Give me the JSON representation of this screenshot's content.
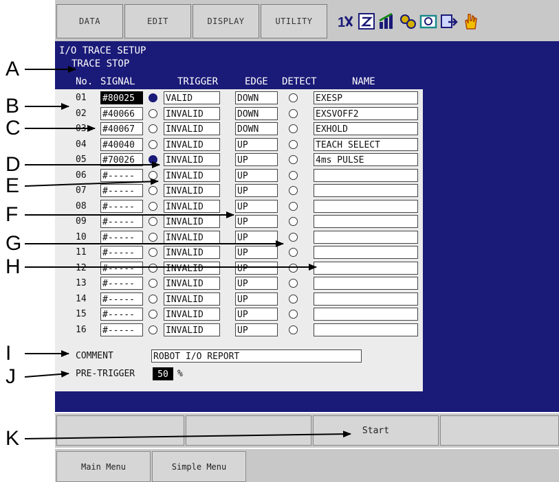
{
  "menu": [
    "DATA",
    "EDIT",
    "DISPLAY",
    "UTILITY"
  ],
  "toolbar_icons": [
    "io-icon",
    "calculator-icon",
    "signal-icon",
    "gears-icon",
    "camera-icon",
    "export-icon",
    "hand-icon"
  ],
  "screen": {
    "title": "I/O TRACE SETUP",
    "status": "TRACE STOP",
    "headers": {
      "no": "No.",
      "signal": "SIGNAL",
      "trigger": "TRIGGER",
      "edge": "EDGE",
      "detect": "DETECT",
      "name": "NAME"
    },
    "rows": [
      {
        "no": "01",
        "signal": "#80025",
        "trigger_on": true,
        "trigger": "VALID",
        "edge": "DOWN",
        "name": "EXESP"
      },
      {
        "no": "02",
        "signal": "#40066",
        "trigger_on": false,
        "trigger": "INVALID",
        "edge": "DOWN",
        "name": "EXSVOFF2"
      },
      {
        "no": "03",
        "signal": "#40067",
        "trigger_on": false,
        "trigger": "INVALID",
        "edge": "DOWN",
        "name": "EXHOLD"
      },
      {
        "no": "04",
        "signal": "#40040",
        "trigger_on": false,
        "trigger": "INVALID",
        "edge": "UP",
        "name": "TEACH SELECT"
      },
      {
        "no": "05",
        "signal": "#70026",
        "trigger_on": true,
        "trigger": "INVALID",
        "edge": "UP",
        "name": "4ms PULSE"
      },
      {
        "no": "06",
        "signal": "#-----",
        "trigger_on": false,
        "trigger": "INVALID",
        "edge": "UP",
        "name": ""
      },
      {
        "no": "07",
        "signal": "#-----",
        "trigger_on": false,
        "trigger": "INVALID",
        "edge": "UP",
        "name": ""
      },
      {
        "no": "08",
        "signal": "#-----",
        "trigger_on": false,
        "trigger": "INVALID",
        "edge": "UP",
        "name": ""
      },
      {
        "no": "09",
        "signal": "#-----",
        "trigger_on": false,
        "trigger": "INVALID",
        "edge": "UP",
        "name": ""
      },
      {
        "no": "10",
        "signal": "#-----",
        "trigger_on": false,
        "trigger": "INVALID",
        "edge": "UP",
        "name": ""
      },
      {
        "no": "11",
        "signal": "#-----",
        "trigger_on": false,
        "trigger": "INVALID",
        "edge": "UP",
        "name": ""
      },
      {
        "no": "12",
        "signal": "#-----",
        "trigger_on": false,
        "trigger": "INVALID",
        "edge": "UP",
        "name": ""
      },
      {
        "no": "13",
        "signal": "#-----",
        "trigger_on": false,
        "trigger": "INVALID",
        "edge": "UP",
        "name": ""
      },
      {
        "no": "14",
        "signal": "#-----",
        "trigger_on": false,
        "trigger": "INVALID",
        "edge": "UP",
        "name": ""
      },
      {
        "no": "15",
        "signal": "#-----",
        "trigger_on": false,
        "trigger": "INVALID",
        "edge": "UP",
        "name": ""
      },
      {
        "no": "16",
        "signal": "#-----",
        "trigger_on": false,
        "trigger": "INVALID",
        "edge": "UP",
        "name": ""
      }
    ],
    "comment_label": "COMMENT",
    "comment_value": "ROBOT I/O REPORT",
    "pretrigger_label": "PRE-TRIGGER",
    "pretrigger_value": "50",
    "pretrigger_unit": "%"
  },
  "function_keys": [
    "",
    "",
    "",
    "Start",
    ""
  ],
  "bottom_menu": [
    "Main Menu",
    "Simple Menu"
  ],
  "callouts": [
    "A",
    "B",
    "C",
    "D",
    "E",
    "F",
    "G",
    "H",
    "I",
    "J",
    "K"
  ],
  "colors": {
    "screen_bg": "#1a1a78",
    "panel_bg": "#ececec",
    "bar_bg": "#c8c8c8"
  }
}
